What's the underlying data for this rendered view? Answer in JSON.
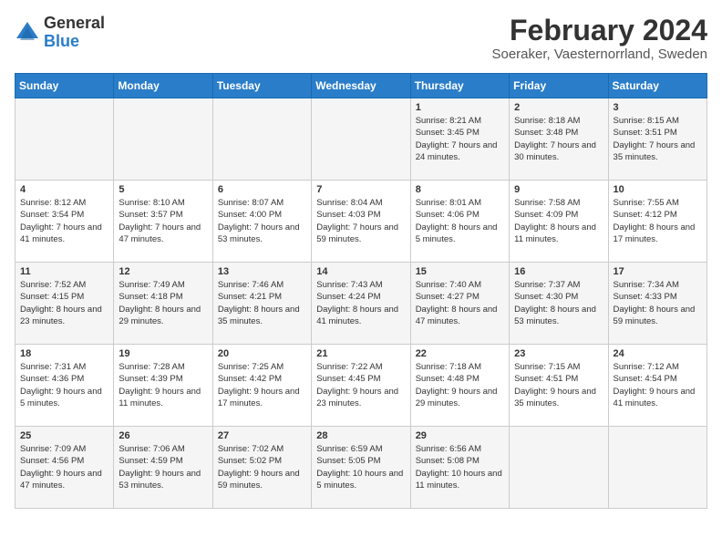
{
  "header": {
    "logo_general": "General",
    "logo_blue": "Blue",
    "month_year": "February 2024",
    "location": "Soeraker, Vaesternorrland, Sweden"
  },
  "weekdays": [
    "Sunday",
    "Monday",
    "Tuesday",
    "Wednesday",
    "Thursday",
    "Friday",
    "Saturday"
  ],
  "weeks": [
    [
      {
        "day": "",
        "info": ""
      },
      {
        "day": "",
        "info": ""
      },
      {
        "day": "",
        "info": ""
      },
      {
        "day": "",
        "info": ""
      },
      {
        "day": "1",
        "info": "Sunrise: 8:21 AM\nSunset: 3:45 PM\nDaylight: 7 hours\nand 24 minutes."
      },
      {
        "day": "2",
        "info": "Sunrise: 8:18 AM\nSunset: 3:48 PM\nDaylight: 7 hours\nand 30 minutes."
      },
      {
        "day": "3",
        "info": "Sunrise: 8:15 AM\nSunset: 3:51 PM\nDaylight: 7 hours\nand 35 minutes."
      }
    ],
    [
      {
        "day": "4",
        "info": "Sunrise: 8:12 AM\nSunset: 3:54 PM\nDaylight: 7 hours\nand 41 minutes."
      },
      {
        "day": "5",
        "info": "Sunrise: 8:10 AM\nSunset: 3:57 PM\nDaylight: 7 hours\nand 47 minutes."
      },
      {
        "day": "6",
        "info": "Sunrise: 8:07 AM\nSunset: 4:00 PM\nDaylight: 7 hours\nand 53 minutes."
      },
      {
        "day": "7",
        "info": "Sunrise: 8:04 AM\nSunset: 4:03 PM\nDaylight: 7 hours\nand 59 minutes."
      },
      {
        "day": "8",
        "info": "Sunrise: 8:01 AM\nSunset: 4:06 PM\nDaylight: 8 hours\nand 5 minutes."
      },
      {
        "day": "9",
        "info": "Sunrise: 7:58 AM\nSunset: 4:09 PM\nDaylight: 8 hours\nand 11 minutes."
      },
      {
        "day": "10",
        "info": "Sunrise: 7:55 AM\nSunset: 4:12 PM\nDaylight: 8 hours\nand 17 minutes."
      }
    ],
    [
      {
        "day": "11",
        "info": "Sunrise: 7:52 AM\nSunset: 4:15 PM\nDaylight: 8 hours\nand 23 minutes."
      },
      {
        "day": "12",
        "info": "Sunrise: 7:49 AM\nSunset: 4:18 PM\nDaylight: 8 hours\nand 29 minutes."
      },
      {
        "day": "13",
        "info": "Sunrise: 7:46 AM\nSunset: 4:21 PM\nDaylight: 8 hours\nand 35 minutes."
      },
      {
        "day": "14",
        "info": "Sunrise: 7:43 AM\nSunset: 4:24 PM\nDaylight: 8 hours\nand 41 minutes."
      },
      {
        "day": "15",
        "info": "Sunrise: 7:40 AM\nSunset: 4:27 PM\nDaylight: 8 hours\nand 47 minutes."
      },
      {
        "day": "16",
        "info": "Sunrise: 7:37 AM\nSunset: 4:30 PM\nDaylight: 8 hours\nand 53 minutes."
      },
      {
        "day": "17",
        "info": "Sunrise: 7:34 AM\nSunset: 4:33 PM\nDaylight: 8 hours\nand 59 minutes."
      }
    ],
    [
      {
        "day": "18",
        "info": "Sunrise: 7:31 AM\nSunset: 4:36 PM\nDaylight: 9 hours\nand 5 minutes."
      },
      {
        "day": "19",
        "info": "Sunrise: 7:28 AM\nSunset: 4:39 PM\nDaylight: 9 hours\nand 11 minutes."
      },
      {
        "day": "20",
        "info": "Sunrise: 7:25 AM\nSunset: 4:42 PM\nDaylight: 9 hours\nand 17 minutes."
      },
      {
        "day": "21",
        "info": "Sunrise: 7:22 AM\nSunset: 4:45 PM\nDaylight: 9 hours\nand 23 minutes."
      },
      {
        "day": "22",
        "info": "Sunrise: 7:18 AM\nSunset: 4:48 PM\nDaylight: 9 hours\nand 29 minutes."
      },
      {
        "day": "23",
        "info": "Sunrise: 7:15 AM\nSunset: 4:51 PM\nDaylight: 9 hours\nand 35 minutes."
      },
      {
        "day": "24",
        "info": "Sunrise: 7:12 AM\nSunset: 4:54 PM\nDaylight: 9 hours\nand 41 minutes."
      }
    ],
    [
      {
        "day": "25",
        "info": "Sunrise: 7:09 AM\nSunset: 4:56 PM\nDaylight: 9 hours\nand 47 minutes."
      },
      {
        "day": "26",
        "info": "Sunrise: 7:06 AM\nSunset: 4:59 PM\nDaylight: 9 hours\nand 53 minutes."
      },
      {
        "day": "27",
        "info": "Sunrise: 7:02 AM\nSunset: 5:02 PM\nDaylight: 9 hours\nand 59 minutes."
      },
      {
        "day": "28",
        "info": "Sunrise: 6:59 AM\nSunset: 5:05 PM\nDaylight: 10 hours\nand 5 minutes."
      },
      {
        "day": "29",
        "info": "Sunrise: 6:56 AM\nSunset: 5:08 PM\nDaylight: 10 hours\nand 11 minutes."
      },
      {
        "day": "",
        "info": ""
      },
      {
        "day": "",
        "info": ""
      }
    ]
  ]
}
